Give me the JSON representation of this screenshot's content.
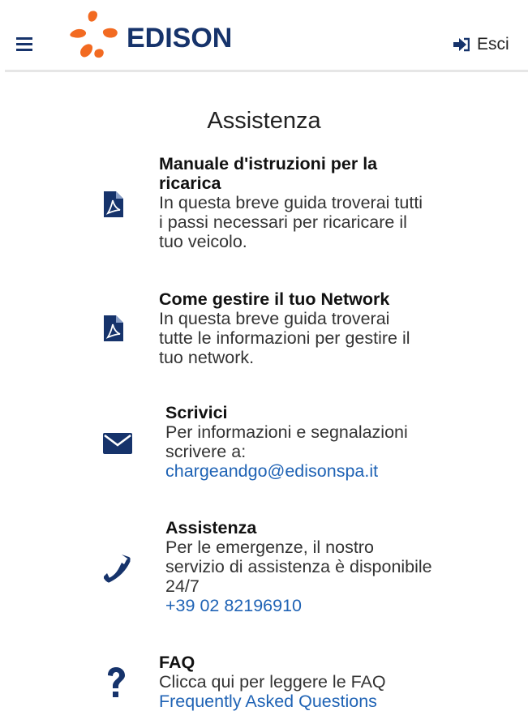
{
  "header": {
    "logo_text": "EDISON",
    "exit_label": "Esci"
  },
  "page": {
    "title": "Assistenza"
  },
  "colors": {
    "brand_orange": "#f26a21",
    "navy": "#16336b",
    "link": "#1f63b5"
  },
  "items": [
    {
      "icon": "pdf-file-icon",
      "title": "Manuale d'istruzioni per la ricarica",
      "description": "In questa breve guida troverai tutti i passi necessari per ricaricare il tuo veicolo."
    },
    {
      "icon": "pdf-file-icon",
      "title": "Come gestire il tuo Network",
      "description": "In questa breve guida troverai tutte le informazioni per gestire il tuo network."
    },
    {
      "icon": "envelope-icon",
      "title": "Scrivici",
      "description": "Per informazioni e segnalazioni scrivere a:",
      "link": "chargeandgo@edisonspa.it"
    },
    {
      "icon": "phone-icon",
      "title": "Assistenza",
      "description": "Per le emergenze, il nostro servizio di assistenza è disponibile 24/7",
      "link": "+39 02 82196910"
    },
    {
      "icon": "question-icon",
      "title": "FAQ",
      "description": "Clicca qui per leggere le FAQ",
      "link": "Frequently Asked Questions"
    }
  ]
}
